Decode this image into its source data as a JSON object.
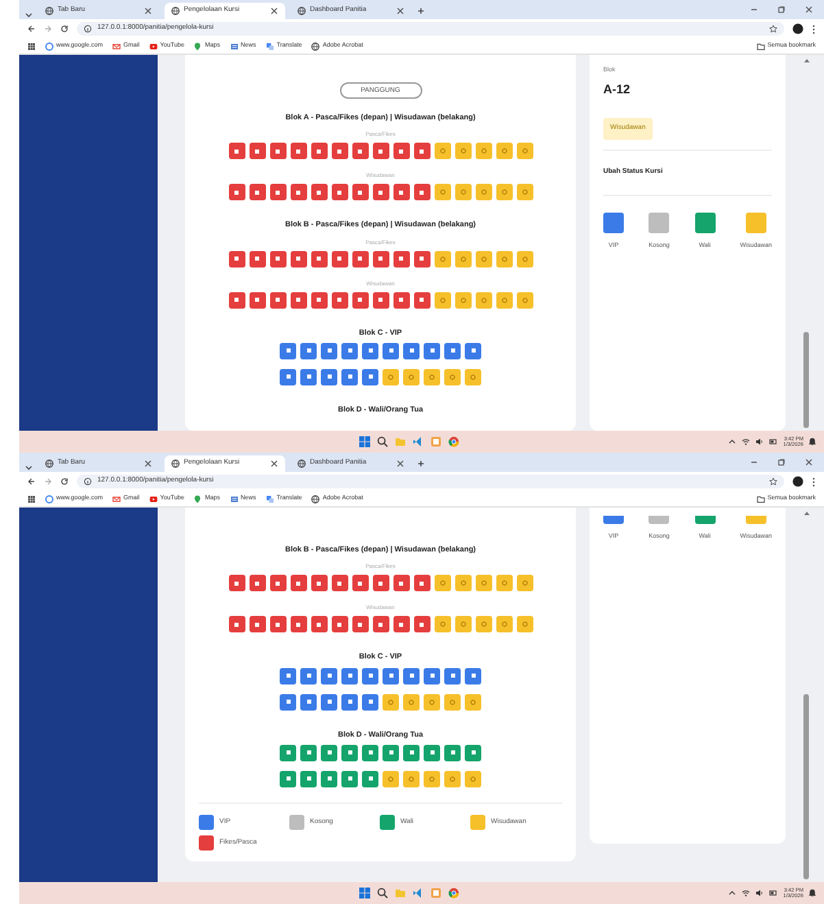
{
  "screens": [
    {
      "browser": {
        "tabs": [
          {
            "label": "Tab Baru",
            "selected": false
          },
          {
            "label": "Pengelolaan Kursi",
            "selected": true
          },
          {
            "label": "Dashboard Panitia",
            "selected": false
          }
        ],
        "url": "127.0.0.1:8000/panitia/pengelola-kursi",
        "bookmarks": [
          "www.google.com",
          "Gmail",
          "YouTube",
          "Maps",
          "News",
          "Translate",
          "Adobe Acrobat"
        ],
        "all_bookmarks": "Semua bookmark"
      },
      "main": {
        "stage": "PANGGUNG",
        "blocks": [
          {
            "title": "Blok A - Pasca/Fikes (depan) | Wisudawan (belakang)",
            "rows": [
              {
                "label": "Pasca/Fikes",
                "seats": [
                  {
                    "kind": "fikes"
                  },
                  {
                    "kind": "fikes"
                  },
                  {
                    "kind": "fikes"
                  },
                  {
                    "kind": "fikes"
                  },
                  {
                    "kind": "fikes"
                  },
                  {
                    "kind": "fikes"
                  },
                  {
                    "kind": "fikes"
                  },
                  {
                    "kind": "fikes"
                  },
                  {
                    "kind": "fikes"
                  },
                  {
                    "kind": "fikes"
                  },
                  {
                    "kind": "wisudawan"
                  },
                  {
                    "kind": "wisudawan"
                  },
                  {
                    "kind": "wisudawan"
                  },
                  {
                    "kind": "wisudawan"
                  },
                  {
                    "kind": "wisudawan"
                  }
                ]
              },
              {
                "label": "Wisudawan",
                "seats": [
                  {
                    "kind": "fikes"
                  },
                  {
                    "kind": "fikes"
                  },
                  {
                    "kind": "fikes"
                  },
                  {
                    "kind": "fikes"
                  },
                  {
                    "kind": "fikes"
                  },
                  {
                    "kind": "fikes"
                  },
                  {
                    "kind": "fikes"
                  },
                  {
                    "kind": "fikes"
                  },
                  {
                    "kind": "fikes"
                  },
                  {
                    "kind": "fikes"
                  },
                  {
                    "kind": "wisudawan"
                  },
                  {
                    "kind": "wisudawan"
                  },
                  {
                    "kind": "wisudawan"
                  },
                  {
                    "kind": "wisudawan"
                  },
                  {
                    "kind": "wisudawan"
                  }
                ]
              }
            ]
          },
          {
            "title": "Blok B - Pasca/Fikes (depan) | Wisudawan (belakang)",
            "rows": [
              {
                "label": "Pasca/Fikes",
                "seats": [
                  {
                    "kind": "fikes"
                  },
                  {
                    "kind": "fikes"
                  },
                  {
                    "kind": "fikes"
                  },
                  {
                    "kind": "fikes"
                  },
                  {
                    "kind": "fikes"
                  },
                  {
                    "kind": "fikes"
                  },
                  {
                    "kind": "fikes"
                  },
                  {
                    "kind": "fikes"
                  },
                  {
                    "kind": "fikes"
                  },
                  {
                    "kind": "fikes"
                  },
                  {
                    "kind": "wisudawan"
                  },
                  {
                    "kind": "wisudawan"
                  },
                  {
                    "kind": "wisudawan"
                  },
                  {
                    "kind": "wisudawan"
                  },
                  {
                    "kind": "wisudawan"
                  }
                ]
              },
              {
                "label": "Wisudawan",
                "seats": [
                  {
                    "kind": "fikes"
                  },
                  {
                    "kind": "fikes"
                  },
                  {
                    "kind": "fikes"
                  },
                  {
                    "kind": "fikes"
                  },
                  {
                    "kind": "fikes"
                  },
                  {
                    "kind": "fikes"
                  },
                  {
                    "kind": "fikes"
                  },
                  {
                    "kind": "fikes"
                  },
                  {
                    "kind": "fikes"
                  },
                  {
                    "kind": "fikes"
                  },
                  {
                    "kind": "wisudawan"
                  },
                  {
                    "kind": "wisudawan"
                  },
                  {
                    "kind": "wisudawan"
                  },
                  {
                    "kind": "wisudawan"
                  },
                  {
                    "kind": "wisudawan"
                  }
                ]
              }
            ]
          },
          {
            "title": "Blok C - VIP",
            "rows": [
              {
                "seats": [
                  {
                    "kind": "vip"
                  },
                  {
                    "kind": "vip"
                  },
                  {
                    "kind": "vip"
                  },
                  {
                    "kind": "vip"
                  },
                  {
                    "kind": "vip"
                  },
                  {
                    "kind": "vip"
                  },
                  {
                    "kind": "vip"
                  },
                  {
                    "kind": "vip"
                  },
                  {
                    "kind": "vip"
                  },
                  {
                    "kind": "vip"
                  }
                ]
              },
              {
                "seats": [
                  {
                    "kind": "vip"
                  },
                  {
                    "kind": "vip"
                  },
                  {
                    "kind": "vip"
                  },
                  {
                    "kind": "vip"
                  },
                  {
                    "kind": "vip"
                  },
                  {
                    "kind": "wisudawan"
                  },
                  {
                    "kind": "wisudawan"
                  },
                  {
                    "kind": "wisudawan"
                  },
                  {
                    "kind": "wisudawan"
                  },
                  {
                    "kind": "wisudawan"
                  }
                ]
              }
            ]
          },
          {
            "title": "Blok D - Wali/Orang Tua"
          }
        ]
      },
      "side": {
        "caption": "Blok",
        "seat": "A-12",
        "badge": "Wisudawan",
        "heading": "Ubah Status Kursi",
        "options": [
          {
            "label": "VIP",
            "color": "#3b7be8"
          },
          {
            "label": "Kosong",
            "color": "#bdbdbd"
          },
          {
            "label": "Wali",
            "color": "#14a46c"
          },
          {
            "label": "Wisudawan",
            "color": "#f6c02b"
          }
        ]
      },
      "taskbar": {
        "time": "3:42 PM",
        "date": "1/3/2026"
      }
    },
    {
      "browser": {
        "tabs": [
          {
            "label": "Tab Baru",
            "selected": false
          },
          {
            "label": "Pengelolaan Kursi",
            "selected": true
          },
          {
            "label": "Dashboard Panitia",
            "selected": false
          }
        ],
        "url": "127.0.0.1:8000/panitia/pengelola-kursi",
        "bookmarks": [
          "www.google.com",
          "Gmail",
          "YouTube",
          "Maps",
          "News",
          "Translate",
          "Adobe Acrobat"
        ],
        "all_bookmarks": "Semua bookmark"
      },
      "main": {
        "blocks": [
          {
            "title": "Blok B - Pasca/Fikes (depan) | Wisudawan (belakang)",
            "rows": [
              {
                "label": "Pasca/Fikes",
                "seats": [
                  {
                    "kind": "fikes"
                  },
                  {
                    "kind": "fikes"
                  },
                  {
                    "kind": "fikes"
                  },
                  {
                    "kind": "fikes"
                  },
                  {
                    "kind": "fikes"
                  },
                  {
                    "kind": "fikes"
                  },
                  {
                    "kind": "fikes"
                  },
                  {
                    "kind": "fikes"
                  },
                  {
                    "kind": "fikes"
                  },
                  {
                    "kind": "fikes"
                  },
                  {
                    "kind": "wisudawan"
                  },
                  {
                    "kind": "wisudawan"
                  },
                  {
                    "kind": "wisudawan"
                  },
                  {
                    "kind": "wisudawan"
                  },
                  {
                    "kind": "wisudawan"
                  }
                ]
              },
              {
                "label": "Wisudawan",
                "seats": [
                  {
                    "kind": "fikes"
                  },
                  {
                    "kind": "fikes"
                  },
                  {
                    "kind": "fikes"
                  },
                  {
                    "kind": "fikes"
                  },
                  {
                    "kind": "fikes"
                  },
                  {
                    "kind": "fikes"
                  },
                  {
                    "kind": "fikes"
                  },
                  {
                    "kind": "fikes"
                  },
                  {
                    "kind": "fikes"
                  },
                  {
                    "kind": "fikes"
                  },
                  {
                    "kind": "wisudawan"
                  },
                  {
                    "kind": "wisudawan"
                  },
                  {
                    "kind": "wisudawan"
                  },
                  {
                    "kind": "wisudawan"
                  },
                  {
                    "kind": "wisudawan"
                  }
                ]
              }
            ]
          },
          {
            "title": "Blok C - VIP",
            "rows": [
              {
                "seats": [
                  {
                    "kind": "vip"
                  },
                  {
                    "kind": "vip"
                  },
                  {
                    "kind": "vip"
                  },
                  {
                    "kind": "vip"
                  },
                  {
                    "kind": "vip"
                  },
                  {
                    "kind": "vip"
                  },
                  {
                    "kind": "vip"
                  },
                  {
                    "kind": "vip"
                  },
                  {
                    "kind": "vip"
                  },
                  {
                    "kind": "vip"
                  }
                ]
              },
              {
                "seats": [
                  {
                    "kind": "vip"
                  },
                  {
                    "kind": "vip"
                  },
                  {
                    "kind": "vip"
                  },
                  {
                    "kind": "vip"
                  },
                  {
                    "kind": "vip"
                  },
                  {
                    "kind": "wisudawan"
                  },
                  {
                    "kind": "wisudawan"
                  },
                  {
                    "kind": "wisudawan"
                  },
                  {
                    "kind": "wisudawan"
                  },
                  {
                    "kind": "wisudawan"
                  }
                ]
              }
            ]
          },
          {
            "title": "Blok D - Wali/Orang Tua",
            "rows": [
              {
                "seats": [
                  {
                    "kind": "wali"
                  },
                  {
                    "kind": "wali"
                  },
                  {
                    "kind": "wali"
                  },
                  {
                    "kind": "wali"
                  },
                  {
                    "kind": "wali"
                  },
                  {
                    "kind": "wali"
                  },
                  {
                    "kind": "wali"
                  },
                  {
                    "kind": "wali"
                  },
                  {
                    "kind": "wali"
                  },
                  {
                    "kind": "wali"
                  }
                ]
              },
              {
                "seats": [
                  {
                    "kind": "wali"
                  },
                  {
                    "kind": "wali"
                  },
                  {
                    "kind": "wali"
                  },
                  {
                    "kind": "wali"
                  },
                  {
                    "kind": "wali"
                  },
                  {
                    "kind": "wisudawan"
                  },
                  {
                    "kind": "wisudawan"
                  },
                  {
                    "kind": "wisudawan"
                  },
                  {
                    "kind": "wisudawan"
                  },
                  {
                    "kind": "wisudawan"
                  }
                ]
              }
            ]
          }
        ],
        "legend": [
          {
            "label": "VIP",
            "color": "#3b7be8"
          },
          {
            "label": "Kosong",
            "color": "#bdbdbd"
          },
          {
            "label": "Wali",
            "color": "#14a46c"
          },
          {
            "label": "Wisudawan",
            "color": "#f6c02b"
          },
          {
            "label": "Fikes/Pasca",
            "color": "#e53e3e"
          }
        ]
      },
      "side": {
        "options": [
          {
            "label": "VIP",
            "color": "#3b7be8"
          },
          {
            "label": "Kosong",
            "color": "#bdbdbd"
          },
          {
            "label": "Wali",
            "color": "#14a46c"
          },
          {
            "label": "Wisudawan",
            "color": "#f6c02b"
          }
        ]
      },
      "taskbar": {
        "time": "3:42 PM",
        "date": "1/3/2026"
      }
    }
  ]
}
